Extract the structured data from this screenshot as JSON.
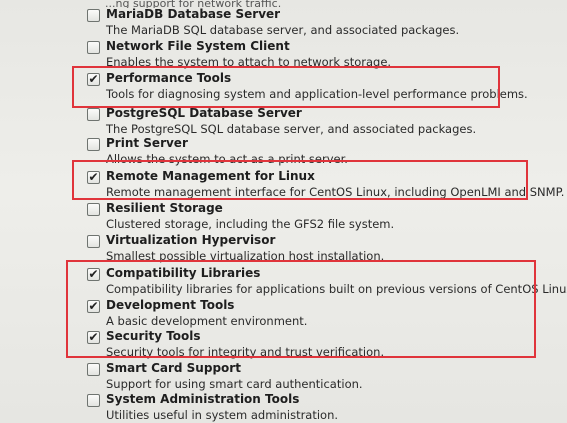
{
  "header_partial": "...ng support for network traffic.",
  "packages": [
    {
      "name": "MariaDB Database Server",
      "description": "The MariaDB SQL database server, and associated packages.",
      "checked": false
    },
    {
      "name": "Network File System Client",
      "description": "Enables the system to attach to network storage.",
      "checked": false
    },
    {
      "name": "Performance Tools",
      "description": "Tools for diagnosing system and application-level performance problems.",
      "checked": true
    },
    {
      "name": "PostgreSQL Database Server",
      "description": "The PostgreSQL SQL database server, and associated packages.",
      "checked": false
    },
    {
      "name": "Print Server",
      "description": "Allows the system to act as a print server.",
      "checked": false
    },
    {
      "name": "Remote Management for Linux",
      "description": "Remote management interface for CentOS Linux, including OpenLMI and SNMP.",
      "checked": true
    },
    {
      "name": "Resilient Storage",
      "description": "Clustered storage, including the GFS2 file system.",
      "checked": false
    },
    {
      "name": "Virtualization Hypervisor",
      "description": "Smallest possible virtualization host installation.",
      "checked": false
    },
    {
      "name": "Compatibility Libraries",
      "description": "Compatibility libraries for applications built on previous versions of CentOS Linux.",
      "checked": true
    },
    {
      "name": "Development Tools",
      "description": "A basic development environment.",
      "checked": true
    },
    {
      "name": "Security Tools",
      "description": "Security tools for integrity and trust verification.",
      "checked": true
    },
    {
      "name": "Smart Card Support",
      "description": "Support for using smart card authentication.",
      "checked": false
    },
    {
      "name": "System Administration Tools",
      "description": "Utilities useful in system administration.",
      "checked": false
    }
  ],
  "check_glyph": "✔",
  "highlight_color": "#e0343b"
}
